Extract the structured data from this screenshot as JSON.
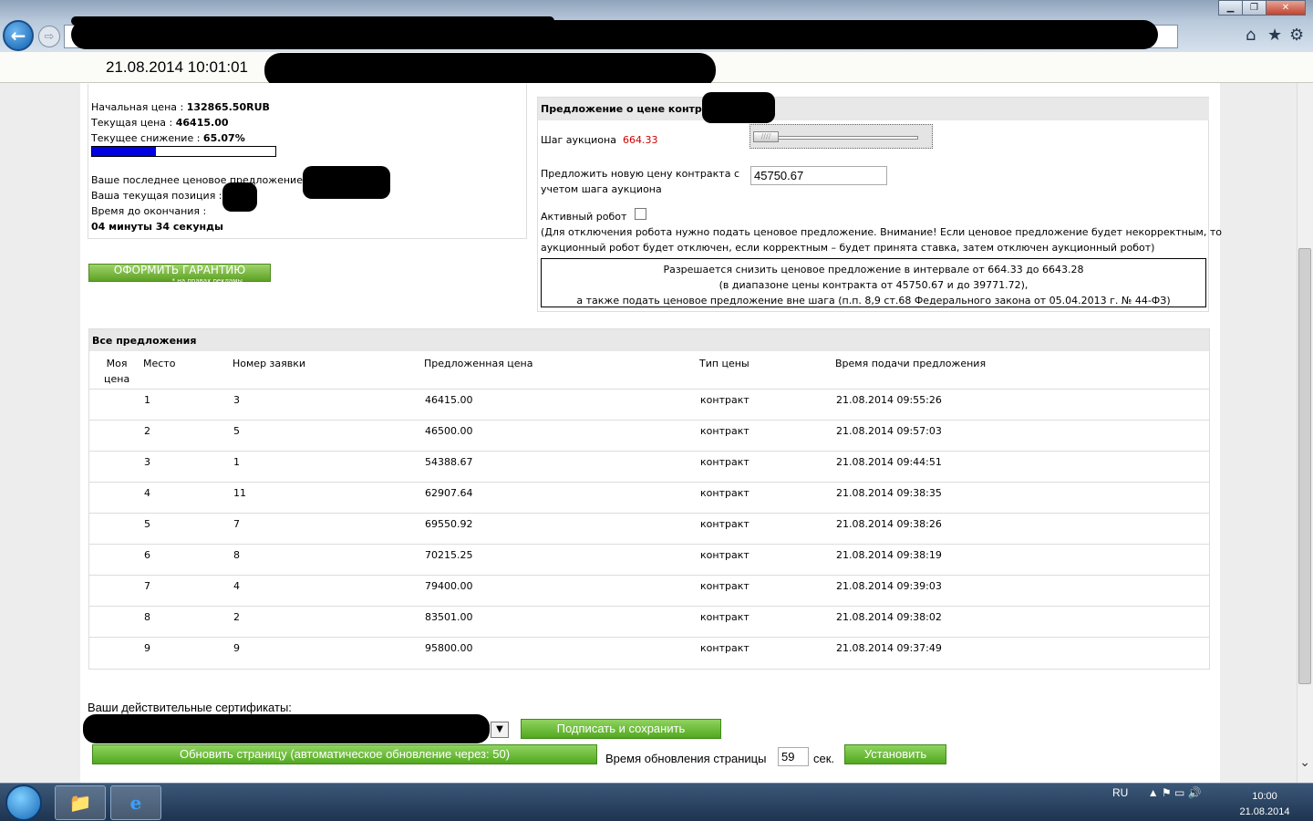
{
  "browser": {
    "back_glyph": "←",
    "forward_glyph": "⇨",
    "home_icon": "⌂",
    "star_icon": "★",
    "gear_icon": "⚙",
    "minimize": "▁",
    "maximize": "❐",
    "close": "✕"
  },
  "title_strip": {
    "datetime": "21.08.2014  10:01:01"
  },
  "left_panel": {
    "start_price_label": "Начальная цена : ",
    "start_price_value": "132865.50RUB",
    "current_price_label": "Текущая цена : ",
    "current_price_value": "46415.00",
    "current_reduction_label": "Текущее снижение : ",
    "current_reduction_value": "65.07%",
    "reduction_fraction": 0.35,
    "last_offer_label": "Ваше последнее ценовое предложение :",
    "current_position_label": "Ваша текущая позиция :",
    "time_left_label": "Время до окончания :",
    "time_left_value": "04 минуты 34 секунды"
  },
  "guarantee": {
    "label": "ОФОРМИТЬ ГАРАНТИЮ",
    "sublabel": "* на правах рекламы"
  },
  "right_panel": {
    "header": "Предложение о цене контракта п",
    "step_label": "Шаг аукциона",
    "step_value": "664.33",
    "slider_handle": "////",
    "new_price_label_line1": "Предложить новую цену контракта с",
    "new_price_label_line2": "учетом шага аукциона",
    "new_price_value": "45750.67",
    "robot_label": "Активный робот",
    "robot_note_line1": "(Для отключения робота нужно подать ценовое предложение. Внимание! Если ценовое предложение будет некорректным, то",
    "robot_note_line2": "аукционный робот будет отключен, если корректным – будет принята ставка, затем отключен аукционный робот)",
    "info_line1": "Разрешается снизить ценовое предложение в интервале  от 664.33  до 6643.28",
    "info_line2": "(в диапазоне цены контракта от 45750.67 и  до 39771.72),",
    "info_line3": "а также подать ценовое предложение вне шага (п.п. 8,9 ст.68 Федерального закона от 05.04.2013 г. № 44-ФЗ)"
  },
  "offers": {
    "title": "Все предложения",
    "columns": {
      "my_price_line1": "Моя",
      "my_price_line2": "цена",
      "place": "Место",
      "bid_number": "Номер заявки",
      "price": "Предложенная цена",
      "price_type": "Тип цены",
      "time": "Время подачи предложения"
    },
    "rows": [
      {
        "place": "1",
        "bid": "3",
        "price": "46415.00",
        "type": "контракт",
        "time": "21.08.2014 09:55:26"
      },
      {
        "place": "2",
        "bid": "5",
        "price": "46500.00",
        "type": "контракт",
        "time": "21.08.2014 09:57:03"
      },
      {
        "place": "3",
        "bid": "1",
        "price": "54388.67",
        "type": "контракт",
        "time": "21.08.2014 09:44:51"
      },
      {
        "place": "4",
        "bid": "11",
        "price": "62907.64",
        "type": "контракт",
        "time": "21.08.2014 09:38:35"
      },
      {
        "place": "5",
        "bid": "7",
        "price": "69550.92",
        "type": "контракт",
        "time": "21.08.2014 09:38:26"
      },
      {
        "place": "6",
        "bid": "8",
        "price": "70215.25",
        "type": "контракт",
        "time": "21.08.2014 09:38:19"
      },
      {
        "place": "7",
        "bid": "4",
        "price": "79400.00",
        "type": "контракт",
        "time": "21.08.2014 09:39:03"
      },
      {
        "place": "8",
        "bid": "2",
        "price": "83501.00",
        "type": "контракт",
        "time": "21.08.2014 09:38:02"
      },
      {
        "place": "9",
        "bid": "9",
        "price": "95800.00",
        "type": "контракт",
        "time": "21.08.2014 09:37:49"
      }
    ]
  },
  "bottom": {
    "cert_label": "Ваши действительные сертификаты:",
    "select_arrow": "▼",
    "sign_button": "Подписать и сохранить",
    "refresh_button": "Обновить страницу (автоматическое обновление через: 50)",
    "refresh_interval_label": "Время обновления страницы",
    "refresh_interval_value": "59",
    "seconds_label": "сек.",
    "set_button": "Установить"
  },
  "taskbar": {
    "language": "RU",
    "time": "10:00",
    "date": "21.08.2014",
    "tray_icons": "▲ ⚑ ▭ 🔊"
  }
}
